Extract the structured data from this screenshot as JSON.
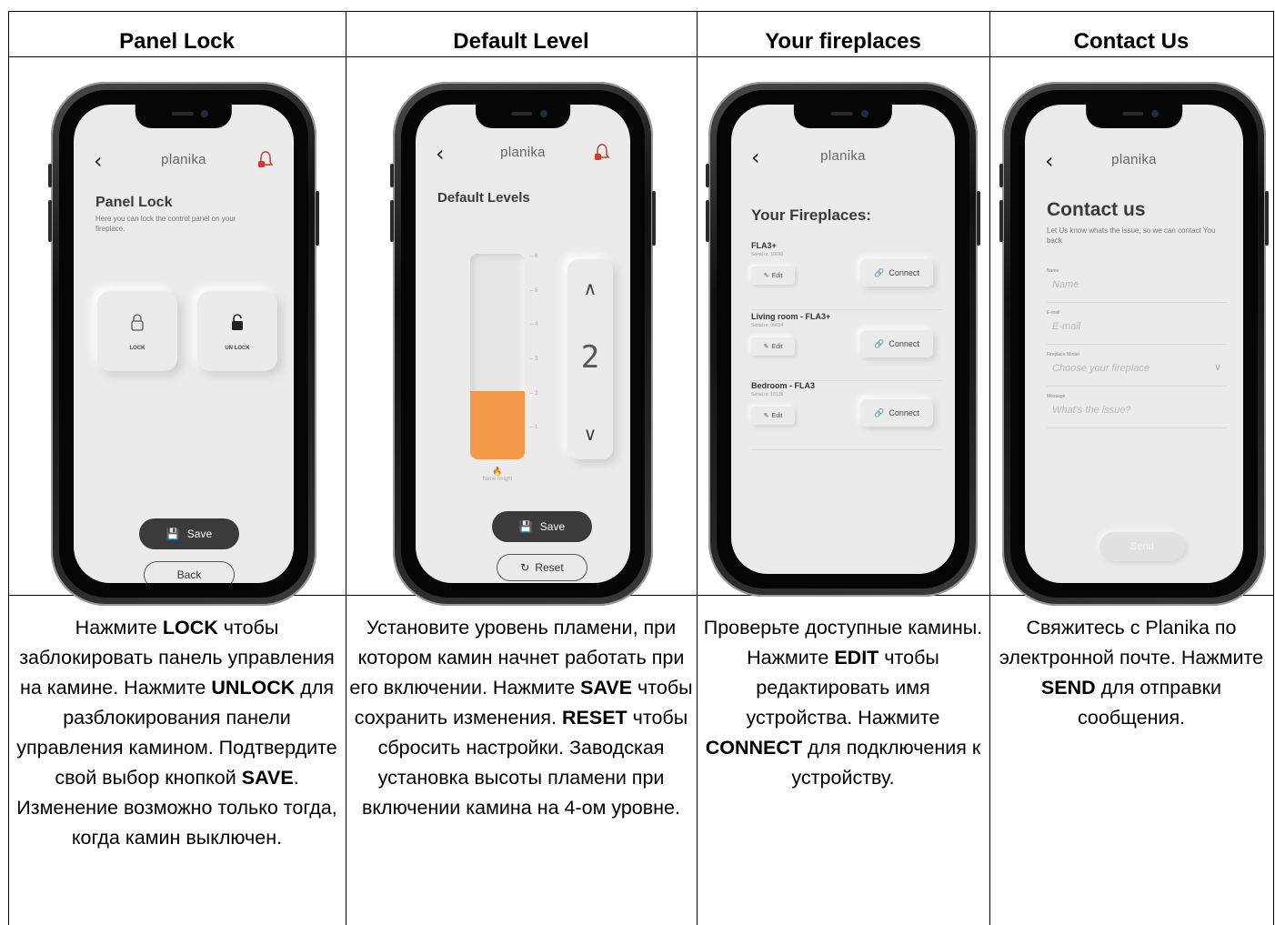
{
  "columns": [
    {
      "title": "Panel Lock",
      "description": [
        {
          "t": "Нажмите "
        },
        {
          "b": "LOCK"
        },
        {
          "t": " чтобы заблокировать панель управления на камине. Нажмите "
        },
        {
          "b": "UNLOCK"
        },
        {
          "t": " для разблокирования панели управления камином. Подтвердите свой выбор кнопкой "
        },
        {
          "b": "SAVE"
        },
        {
          "t": ". Изменение возможно только тогда, когда камин выключен."
        }
      ],
      "screen": {
        "brand": "planika",
        "title": "Panel Lock",
        "subtitle": "Here you can lock the control panel on your fireplace.",
        "lock_label": "LOCK",
        "unlock_label": "UN LOCK",
        "save_label": "Save",
        "back_label": "Back"
      }
    },
    {
      "title": "Default Level",
      "description": [
        {
          "t": "Установите уровень пламени, при котором камин начнет работать при его включении. Нажмите "
        },
        {
          "b": "SAVE"
        },
        {
          "t": " чтобы сохранить изменения. "
        },
        {
          "b": "RESET"
        },
        {
          "t": " чтобы сбросить настройки. Заводская установка высоты пламени при включении камина на 4-ом уровне."
        }
      ],
      "screen": {
        "brand": "planika",
        "title": "Default Levels",
        "level_value": "2",
        "level_max": 6,
        "ticks": [
          "6",
          "5",
          "4",
          "3",
          "2",
          "1"
        ],
        "flame_caption": "flame height",
        "save_label": "Save",
        "reset_label": "Reset",
        "fill_color": "#f29a4a"
      }
    },
    {
      "title": "Your fireplaces",
      "description": [
        {
          "t": "Проверьте доступные камины. Нажмите "
        },
        {
          "b": "EDIT"
        },
        {
          "t": " чтобы редактировать имя устройства. Нажмите "
        },
        {
          "b": "CONNECT"
        },
        {
          "t": " для подключения к устройству."
        }
      ],
      "screen": {
        "brand": "planika",
        "title": "Your Fireplaces:",
        "edit_label": "Edit",
        "connect_label": "Connect",
        "items": [
          {
            "name": "FLA3+",
            "serial": "Serial nr: 10010"
          },
          {
            "name": "Living room - FLA3+",
            "serial": "Serial nr: 09614"
          },
          {
            "name": "Bedroom - FLA3",
            "serial": "Serial nr: 10136"
          }
        ]
      }
    },
    {
      "title": "Contact Us",
      "description": [
        {
          "t": "Свяжитесь с Planika по электронной почте. Нажмите "
        },
        {
          "b": "SEND"
        },
        {
          "t": " для отправки сообщения."
        }
      ],
      "screen": {
        "brand": "planika",
        "title": "Contact us",
        "subtitle": "Let Us know whats the issue, so we can contact You back",
        "fields": [
          {
            "label": "Name",
            "placeholder": "Name"
          },
          {
            "label": "E-mail",
            "placeholder": "E-mail"
          },
          {
            "label": "Fireplace Model",
            "placeholder": "Choose your fireplace"
          },
          {
            "label": "Message",
            "placeholder": "What's the issue?"
          }
        ],
        "send_label": "Send"
      }
    }
  ]
}
